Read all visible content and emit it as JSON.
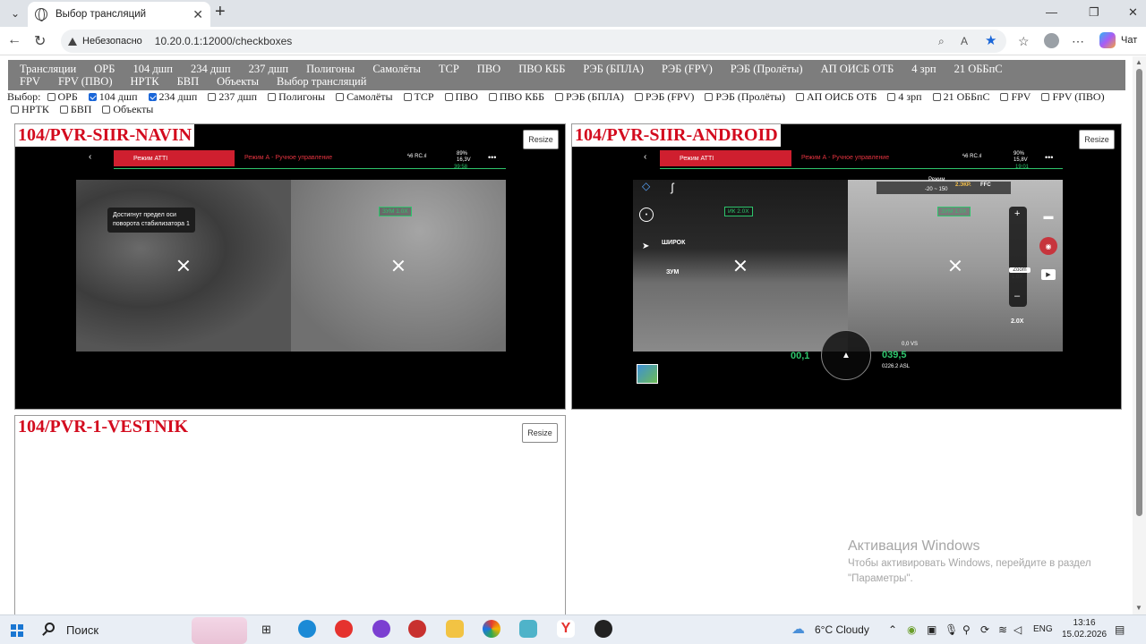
{
  "browser": {
    "tab_title": "Выбор трансляций",
    "insecure_label": "Небезопасно",
    "url": "10.20.0.1:12000/checkboxes",
    "chat_label": "Чат"
  },
  "navbar": {
    "links": [
      "Трансляции",
      "ОРБ",
      "104 дшп",
      "234 дшп",
      "237 дшп",
      "Полигоны",
      "Самолёты",
      "ТСР",
      "ПВО",
      "ПВО КББ",
      "РЭБ (БПЛА)",
      "РЭБ (FPV)",
      "РЭБ (Пролёты)",
      "АП ОИСБ ОТБ",
      "4 зрп",
      "21 ОББпС",
      "FPV",
      "FPV (ПВО)",
      "НРТК",
      "БВП",
      "Объекты",
      "Выбор трансляций"
    ]
  },
  "chooser": {
    "label": "Выбор:",
    "options": [
      {
        "label": "ОРБ",
        "checked": false
      },
      {
        "label": "104 дшп",
        "checked": true
      },
      {
        "label": "234 дшп",
        "checked": true
      },
      {
        "label": "237 дшп",
        "checked": false
      },
      {
        "label": "Полигоны",
        "checked": false
      },
      {
        "label": "Самолёты",
        "checked": false
      },
      {
        "label": "ТСР",
        "checked": false
      },
      {
        "label": "ПВО",
        "checked": false
      },
      {
        "label": "ПВО КББ",
        "checked": false
      },
      {
        "label": "РЭБ (БПЛА)",
        "checked": false
      },
      {
        "label": "РЭБ (FPV)",
        "checked": false
      },
      {
        "label": "РЭБ (Пролёты)",
        "checked": false
      },
      {
        "label": "АП ОИСБ ОТБ",
        "checked": false
      },
      {
        "label": "4 зрп",
        "checked": false
      },
      {
        "label": "21 ОББпС",
        "checked": false
      },
      {
        "label": "FPV",
        "checked": false
      },
      {
        "label": "FPV (ПВО)",
        "checked": false
      },
      {
        "label": "НРТК",
        "checked": false
      },
      {
        "label": "БВП",
        "checked": false
      },
      {
        "label": "Объекты",
        "checked": false
      }
    ]
  },
  "streams": [
    {
      "title": "104/PVR-SIIR-NAVIN",
      "resize_label": "Resize",
      "osd_mode": "Режим ATTI",
      "osd_mode2": "Режим А - Ручное управление",
      "battery": "89%",
      "voltage": "16,3V",
      "time": "39:58",
      "zoom_tag": "ЗУМ 1.0X",
      "tooltip_line1": "Достигнут предел оси",
      "tooltip_line2": "поворота стабилизатора 1"
    },
    {
      "title": "104/PVR-SIIR-ANDROID",
      "resize_label": "Resize",
      "osd_mode": "Режим ATTI",
      "osd_mode2": "Режим А - Ручное управление",
      "battery": "90%",
      "voltage": "15,8V",
      "time": "19:01",
      "ir_tag": "ИК 2.0X",
      "zoom_tag": "ЗУМ 1.0X",
      "wide_label": "ШИРОК",
      "zoom_label": "ЗУМ",
      "range_label": "Режим",
      "range_value": "-20 ~ 150",
      "ir_label": "2.ЭКР.",
      "ffc_label": "FFC",
      "zoom_caption": "Zoom",
      "zoom_value": "1.0X",
      "zoom_bottom": "2.0X",
      "speed_left": "00,1",
      "altitude": "039,5",
      "vs_label": "0,0 VS",
      "asl_label": "0226.2 ASL"
    },
    {
      "title": "104/PVR-1-VESTNIK",
      "resize_label": "Resize"
    }
  ],
  "watermark": {
    "title": "Активация Windows",
    "line1": "Чтобы активировать Windows, перейдите в раздел",
    "line2": "\"Параметры\"."
  },
  "taskbar": {
    "search_label": "Поиск",
    "weather": "6°C  Cloudy",
    "lang": "ENG",
    "time": "13:16",
    "date": "15.02.2026"
  },
  "colors": {
    "title_red": "#d30b1e",
    "navbar_gray": "#7d7d7d",
    "osd_red": "#cf1f2f",
    "osd_green": "#2ec56c",
    "checkbox_blue": "#1a66d8"
  }
}
